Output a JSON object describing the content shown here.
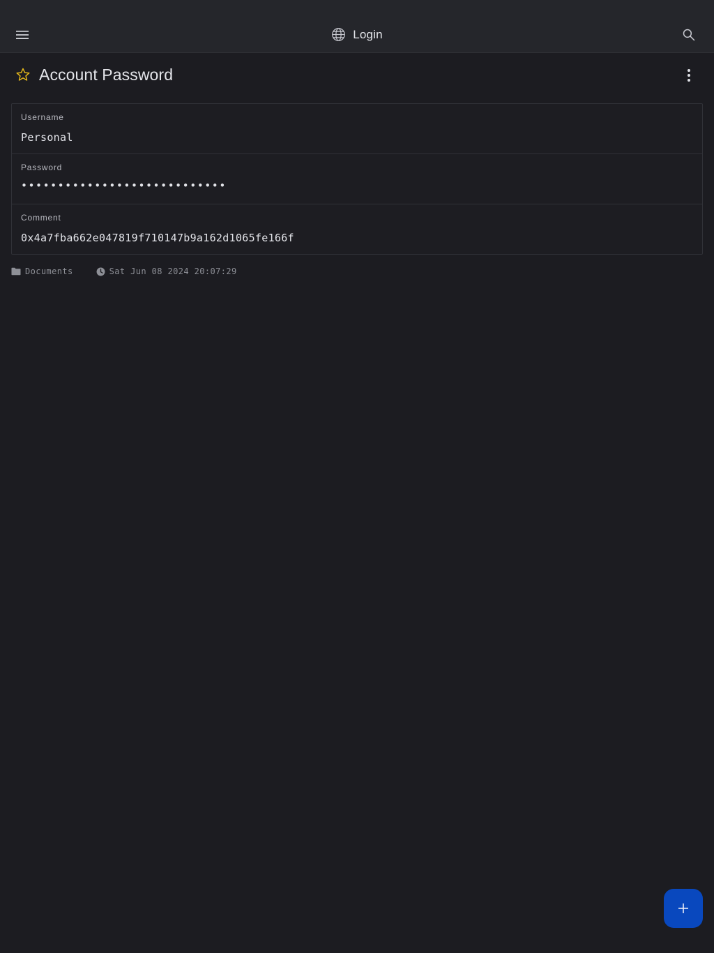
{
  "header": {
    "title": "Login",
    "menu_icon": "hamburger-menu-icon",
    "title_icon": "globe-icon",
    "search_icon": "search-icon"
  },
  "item": {
    "title": "Account Password",
    "favorite_icon": "star-outline-icon",
    "more_icon": "more-vertical-icon",
    "fields": [
      {
        "label": "Username",
        "value": "Personal"
      },
      {
        "label": "Password",
        "value": "••••••••••••••••••••••••••••"
      },
      {
        "label": "Comment",
        "value": "0x4a7fba662e047819f710147b9a162d1065fe166f"
      }
    ],
    "folder": "Documents",
    "modified": "Sat Jun 08 2024 20:07:29"
  },
  "fab": {
    "icon": "plus-icon"
  },
  "colors": {
    "background": "#1c1c21",
    "topbar": "#25262b",
    "star": "#e5b81a",
    "fab": "#0948be"
  }
}
